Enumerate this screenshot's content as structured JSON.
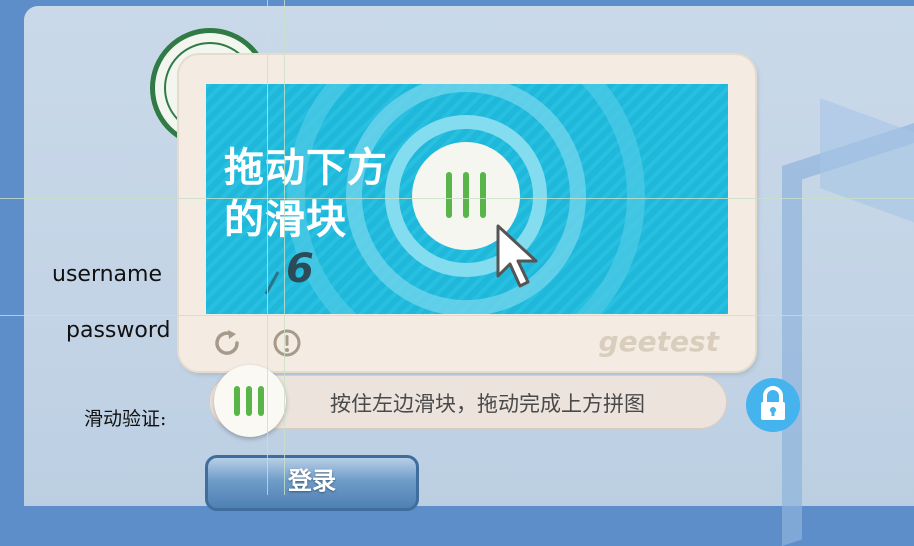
{
  "login_form": {
    "username_label": "username",
    "password_label": "password",
    "slider_label": "滑动验证:",
    "login_button": "登录"
  },
  "captcha": {
    "image_text": "拖动下方\n的滑块",
    "image_digit": "6",
    "brand": "geetest",
    "icons": [
      "refresh-icon",
      "info-icon",
      "cursor-icon"
    ],
    "slider_hint": "按住左边滑块，拖动完成上方拼图",
    "lock_icon": "lock-icon"
  },
  "colors": {
    "captcha_bg": "#1fb8da",
    "slider_bars": "#59b44a",
    "lock_button": "#45b3ee"
  }
}
